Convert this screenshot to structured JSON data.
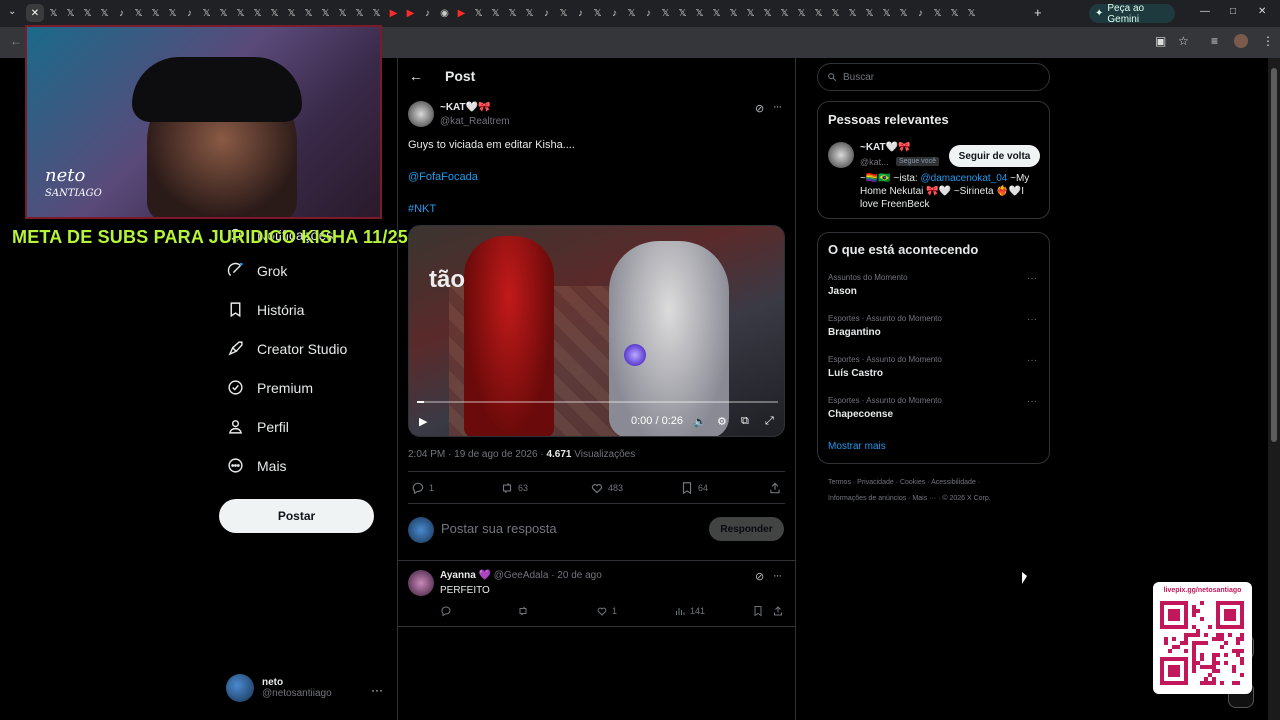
{
  "browser": {
    "tab_icons": [
      "x",
      "x",
      "x",
      "x",
      "tiktok",
      "x",
      "x",
      "x",
      "tiktok",
      "x",
      "x",
      "x",
      "x",
      "x",
      "x",
      "x",
      "x",
      "x",
      "x",
      "x",
      "youtube",
      "youtube",
      "tiktok",
      "chrome",
      "youtube",
      "x",
      "x",
      "x",
      "x",
      "tiktok",
      "x",
      "tiktok",
      "x",
      "tiktok",
      "x",
      "tiktok",
      "x",
      "x",
      "x",
      "x",
      "x",
      "x",
      "x",
      "x",
      "x",
      "x",
      "x",
      "x",
      "x",
      "x",
      "x",
      "tiktok",
      "x",
      "x",
      "x"
    ],
    "gemini_button": "Peça ao Gemini",
    "window_controls": [
      "—",
      "□",
      "✕"
    ]
  },
  "overlay": {
    "webcam_logo_line1": "neto",
    "webcam_logo_line2": "SANTIAGO",
    "subs_goal": "META DE SUBS PARA JURIDICO KISHA 11/25",
    "qr_label": "livepix.gg/netosantiago"
  },
  "nav": {
    "items": [
      {
        "label": "Notificações",
        "icon": "bell-icon"
      },
      {
        "label": "Grok",
        "icon": "grok-icon"
      },
      {
        "label": "História",
        "icon": "bookmark-icon"
      },
      {
        "label": "Creator Studio",
        "icon": "rocket-icon"
      },
      {
        "label": "Premium",
        "icon": "verified-icon"
      },
      {
        "label": "Perfil",
        "icon": "person-icon"
      },
      {
        "label": "Mais",
        "icon": "more-circle-icon"
      }
    ],
    "post_button": "Postar",
    "account_name": "neto",
    "account_handle": "@netosantiiago",
    "account_more": "···"
  },
  "post": {
    "header_title": "Post",
    "author_name": "~KAT🤍🎀",
    "author_handle": "@kat_Realtrem",
    "text": "Guys to viciada em editar Kisha....",
    "mention": "@FofaFocada",
    "hashtag": "#NKT",
    "video": {
      "caption": "tão",
      "time": "0:00 / 0:26",
      "progress": 0.02
    },
    "timestamp": "2:04 PM · 19 de ago de 2026 · ",
    "views_count": "4.671",
    "views_label": " Visualizações",
    "stats": {
      "replies": "1",
      "reposts": "63",
      "likes": "483",
      "bookmarks": "64"
    },
    "reply_placeholder": "Postar sua resposta",
    "reply_button": "Responder"
  },
  "comment": {
    "name": "Ayanna 💜",
    "handle": "@GeeAdala",
    "time": " · 20 de ago",
    "text": "PERFEITO",
    "likes": "1",
    "views": "141"
  },
  "sidebar": {
    "search_placeholder": "Buscar",
    "relevant": {
      "title": "Pessoas relevantes",
      "name": "~KAT🤍🎀",
      "handle": "@kat...",
      "follows_you": "Segue você",
      "follow_button": "Seguir de volta",
      "bio_prefix": "~🏳️‍🌈🇧🇷 ~ista: ",
      "bio_link": "@damacenokat_04",
      "bio_suffix": " ~My Home Nekutai 🎀🤍 ~Sirineta ❤️‍🔥🤍I love FreenBeck"
    },
    "trends": {
      "title": "O que está acontecendo",
      "items": [
        {
          "category": "Assuntos do Momento",
          "name": "Jason"
        },
        {
          "category": "Esportes · Assunto do Momento",
          "name": "Bragantino"
        },
        {
          "category": "Esportes · Assunto do Momento",
          "name": "Luís Castro"
        },
        {
          "category": "Esportes · Assunto do Momento",
          "name": "Chapecoense"
        }
      ],
      "show_more": "Mostrar mais"
    },
    "footer_line1": "Termos  ·  Privacidade  ·  Cookies  ·  Acessibilidade  ·",
    "footer_line2": "Informações de anúncios  ·  Mais ···  ·  © 2026 X Corp."
  }
}
